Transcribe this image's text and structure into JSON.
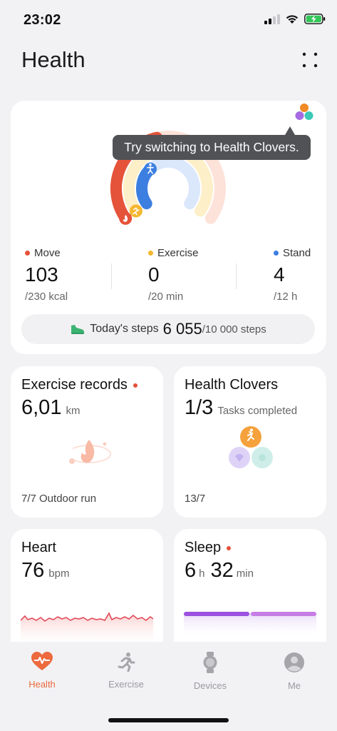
{
  "status_bar": {
    "time": "23:02"
  },
  "header": {
    "title": "Health"
  },
  "tooltip": "Try switching to Health Clovers.",
  "metrics": [
    {
      "label": "Move",
      "value": "103",
      "goal": "/230 kcal",
      "color": "#e5533a"
    },
    {
      "label": "Exercise",
      "value": "0",
      "goal": "/20 min",
      "color": "#f5b731"
    },
    {
      "label": "Stand",
      "value": "4",
      "goal": "/12 h",
      "color": "#3d7fe0"
    }
  ],
  "rings": [
    {
      "name": "Move",
      "fraction": 0.45,
      "color": "#e5533a",
      "track": "#fde2d9"
    },
    {
      "name": "Exercise",
      "fraction": 0.0,
      "color": "#f5b731",
      "track": "#fdefc8"
    },
    {
      "name": "Stand",
      "fraction": 0.33,
      "color": "#3d7fe0",
      "track": "#dbe7fb"
    }
  ],
  "steps": {
    "label": "Today's steps",
    "value": "6 055",
    "goal": "/10 000 steps"
  },
  "tiles": {
    "exercise_records": {
      "title": "Exercise records",
      "value": "6,01",
      "unit": "km",
      "footer": "7/7 Outdoor run"
    },
    "health_clovers": {
      "title": "Health Clovers",
      "value": "1/3",
      "unit": "Tasks completed",
      "footer": "13/7"
    },
    "heart": {
      "title": "Heart",
      "value": "76",
      "unit": "bpm"
    },
    "sleep": {
      "title": "Sleep",
      "hours": "6",
      "hours_unit": "h",
      "minutes": "32",
      "minutes_unit": "min"
    }
  },
  "tabs": [
    {
      "label": "Health",
      "icon": "heart-pulse-icon",
      "active": true
    },
    {
      "label": "Exercise",
      "icon": "running-icon",
      "active": false
    },
    {
      "label": "Devices",
      "icon": "watch-icon",
      "active": false
    },
    {
      "label": "Me",
      "icon": "profile-icon",
      "active": false
    }
  ],
  "colors": {
    "accent": "#ec6a3e",
    "move": "#e5533a",
    "exercise": "#f5b731",
    "stand": "#3d7fe0",
    "sleep": "#a55be0"
  }
}
